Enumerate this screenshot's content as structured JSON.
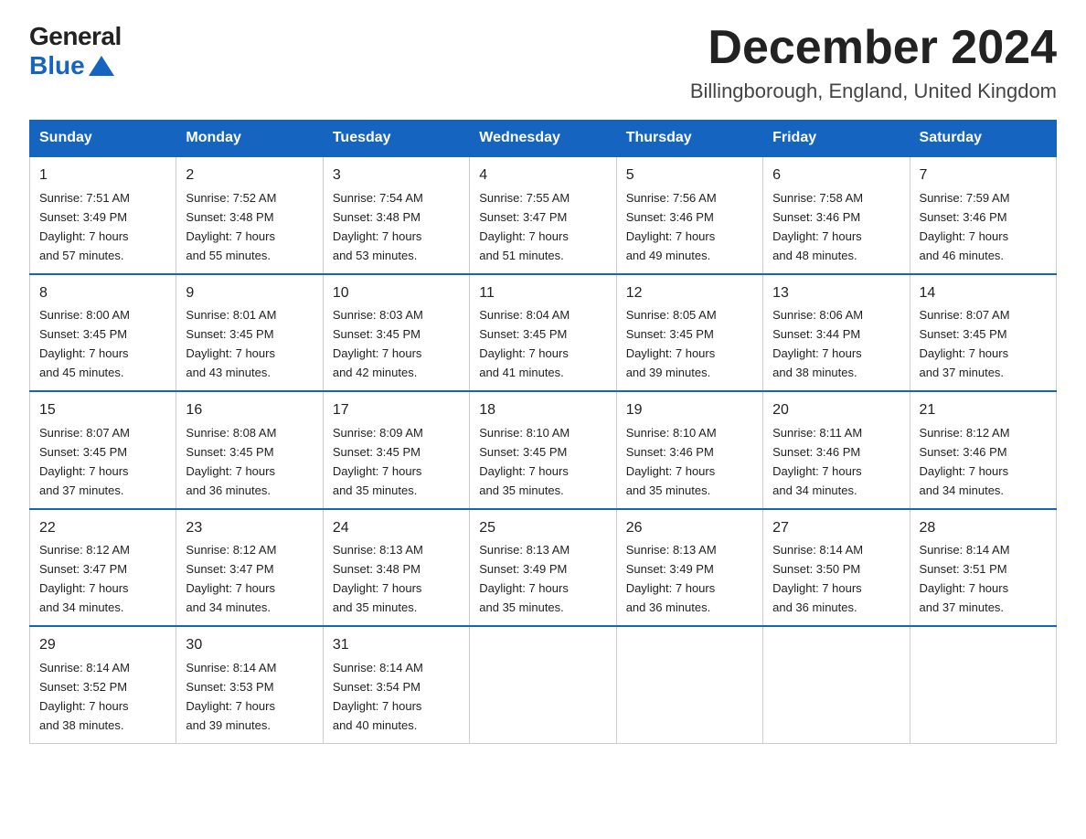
{
  "logo": {
    "general": "General",
    "blue": "Blue"
  },
  "title": "December 2024",
  "subtitle": "Billingborough, England, United Kingdom",
  "weekdays": [
    "Sunday",
    "Monday",
    "Tuesday",
    "Wednesday",
    "Thursday",
    "Friday",
    "Saturday"
  ],
  "weeks": [
    [
      {
        "day": "1",
        "sunrise": "7:51 AM",
        "sunset": "3:49 PM",
        "daylight": "7 hours and 57 minutes."
      },
      {
        "day": "2",
        "sunrise": "7:52 AM",
        "sunset": "3:48 PM",
        "daylight": "7 hours and 55 minutes."
      },
      {
        "day": "3",
        "sunrise": "7:54 AM",
        "sunset": "3:48 PM",
        "daylight": "7 hours and 53 minutes."
      },
      {
        "day": "4",
        "sunrise": "7:55 AM",
        "sunset": "3:47 PM",
        "daylight": "7 hours and 51 minutes."
      },
      {
        "day": "5",
        "sunrise": "7:56 AM",
        "sunset": "3:46 PM",
        "daylight": "7 hours and 49 minutes."
      },
      {
        "day": "6",
        "sunrise": "7:58 AM",
        "sunset": "3:46 PM",
        "daylight": "7 hours and 48 minutes."
      },
      {
        "day": "7",
        "sunrise": "7:59 AM",
        "sunset": "3:46 PM",
        "daylight": "7 hours and 46 minutes."
      }
    ],
    [
      {
        "day": "8",
        "sunrise": "8:00 AM",
        "sunset": "3:45 PM",
        "daylight": "7 hours and 45 minutes."
      },
      {
        "day": "9",
        "sunrise": "8:01 AM",
        "sunset": "3:45 PM",
        "daylight": "7 hours and 43 minutes."
      },
      {
        "day": "10",
        "sunrise": "8:03 AM",
        "sunset": "3:45 PM",
        "daylight": "7 hours and 42 minutes."
      },
      {
        "day": "11",
        "sunrise": "8:04 AM",
        "sunset": "3:45 PM",
        "daylight": "7 hours and 41 minutes."
      },
      {
        "day": "12",
        "sunrise": "8:05 AM",
        "sunset": "3:45 PM",
        "daylight": "7 hours and 39 minutes."
      },
      {
        "day": "13",
        "sunrise": "8:06 AM",
        "sunset": "3:44 PM",
        "daylight": "7 hours and 38 minutes."
      },
      {
        "day": "14",
        "sunrise": "8:07 AM",
        "sunset": "3:45 PM",
        "daylight": "7 hours and 37 minutes."
      }
    ],
    [
      {
        "day": "15",
        "sunrise": "8:07 AM",
        "sunset": "3:45 PM",
        "daylight": "7 hours and 37 minutes."
      },
      {
        "day": "16",
        "sunrise": "8:08 AM",
        "sunset": "3:45 PM",
        "daylight": "7 hours and 36 minutes."
      },
      {
        "day": "17",
        "sunrise": "8:09 AM",
        "sunset": "3:45 PM",
        "daylight": "7 hours and 35 minutes."
      },
      {
        "day": "18",
        "sunrise": "8:10 AM",
        "sunset": "3:45 PM",
        "daylight": "7 hours and 35 minutes."
      },
      {
        "day": "19",
        "sunrise": "8:10 AM",
        "sunset": "3:46 PM",
        "daylight": "7 hours and 35 minutes."
      },
      {
        "day": "20",
        "sunrise": "8:11 AM",
        "sunset": "3:46 PM",
        "daylight": "7 hours and 34 minutes."
      },
      {
        "day": "21",
        "sunrise": "8:12 AM",
        "sunset": "3:46 PM",
        "daylight": "7 hours and 34 minutes."
      }
    ],
    [
      {
        "day": "22",
        "sunrise": "8:12 AM",
        "sunset": "3:47 PM",
        "daylight": "7 hours and 34 minutes."
      },
      {
        "day": "23",
        "sunrise": "8:12 AM",
        "sunset": "3:47 PM",
        "daylight": "7 hours and 34 minutes."
      },
      {
        "day": "24",
        "sunrise": "8:13 AM",
        "sunset": "3:48 PM",
        "daylight": "7 hours and 35 minutes."
      },
      {
        "day": "25",
        "sunrise": "8:13 AM",
        "sunset": "3:49 PM",
        "daylight": "7 hours and 35 minutes."
      },
      {
        "day": "26",
        "sunrise": "8:13 AM",
        "sunset": "3:49 PM",
        "daylight": "7 hours and 36 minutes."
      },
      {
        "day": "27",
        "sunrise": "8:14 AM",
        "sunset": "3:50 PM",
        "daylight": "7 hours and 36 minutes."
      },
      {
        "day": "28",
        "sunrise": "8:14 AM",
        "sunset": "3:51 PM",
        "daylight": "7 hours and 37 minutes."
      }
    ],
    [
      {
        "day": "29",
        "sunrise": "8:14 AM",
        "sunset": "3:52 PM",
        "daylight": "7 hours and 38 minutes."
      },
      {
        "day": "30",
        "sunrise": "8:14 AM",
        "sunset": "3:53 PM",
        "daylight": "7 hours and 39 minutes."
      },
      {
        "day": "31",
        "sunrise": "8:14 AM",
        "sunset": "3:54 PM",
        "daylight": "7 hours and 40 minutes."
      },
      null,
      null,
      null,
      null
    ]
  ],
  "labels": {
    "sunrise": "Sunrise:",
    "sunset": "Sunset:",
    "daylight": "Daylight:"
  }
}
